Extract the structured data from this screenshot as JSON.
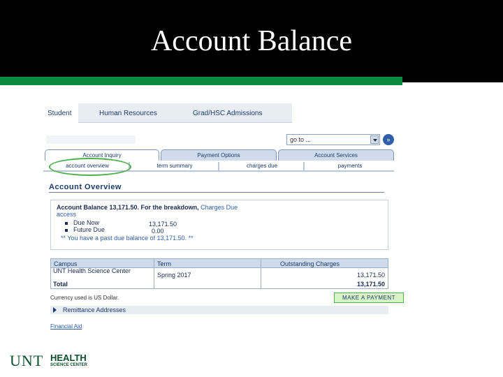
{
  "slide": {
    "title": "Account Balance"
  },
  "nav": {
    "top_tabs": [
      "Student",
      "Human Resources",
      "Grad/HSC Admissions"
    ],
    "goto_label": "go to ...",
    "go_icon": "double-chevron-right-icon"
  },
  "tabs_row1": [
    "Account Inquiry",
    "Payment Options",
    "Account Services"
  ],
  "tabs_row2": [
    "account overview",
    "term summary",
    "charges due",
    "payments"
  ],
  "overview": {
    "title": "Account Overview",
    "balance_line": "Account Balance 13,171.50.  For the breakdown,",
    "balance_link": "Charges Due",
    "access": "access",
    "items": [
      {
        "label": "Due Now",
        "value": "13,171.50"
      },
      {
        "label": "Future Due",
        "value": "0.00"
      }
    ],
    "warning": "** You have a past due balance of 13,171.50. **"
  },
  "charges": {
    "headers": [
      "Campus",
      "Term",
      "Outstanding Charges"
    ],
    "rows": [
      {
        "campus": "UNT Health Science Center",
        "term": "Spring 2017",
        "amount": "13,171.50"
      }
    ],
    "total_label": "Total",
    "total_value": "13,171.50"
  },
  "currency_note": "Currency used is US Dollar.",
  "payment_button": "MAKE A PAYMENT",
  "remittance": "Remittance Addresses",
  "financial_aid": "Financial Aid",
  "logo": {
    "unt": "UNT",
    "health": "HEALTH",
    "sub": "SCIENCE CENTER"
  },
  "colors": {
    "accent_green": "#0a8a3c",
    "link_blue": "#2f5fa8",
    "header_black": "#000000"
  }
}
